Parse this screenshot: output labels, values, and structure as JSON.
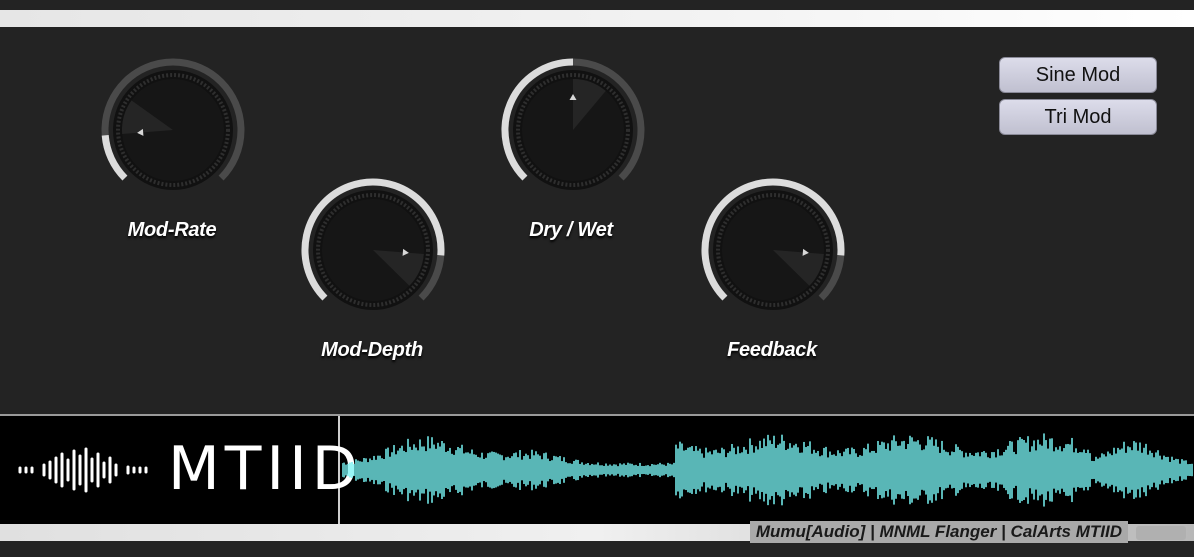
{
  "knobs": [
    {
      "id": "mod-rate",
      "label": "Mod-Rate",
      "value": 0.15
    },
    {
      "id": "mod-depth",
      "label": "Mod-Depth",
      "value": 0.85
    },
    {
      "id": "dry-wet",
      "label": "Dry / Wet",
      "value": 0.5
    },
    {
      "id": "feedback",
      "label": "Feedback",
      "value": 0.85
    }
  ],
  "buttons": {
    "sine_mod": "Sine Mod",
    "tri_mod": "Tri Mod"
  },
  "logo": {
    "text": "MTIID"
  },
  "footer": {
    "credit": "Mumu[Audio] | MNML Flanger | CalArts MTIID"
  },
  "colors": {
    "background": "#232323",
    "waveform": "#77f2f2",
    "knob_arc": "#dcdcdc",
    "knob_track": "#4a4a4a"
  },
  "icons": {
    "logo_waveform": "audio-wave-icon"
  }
}
